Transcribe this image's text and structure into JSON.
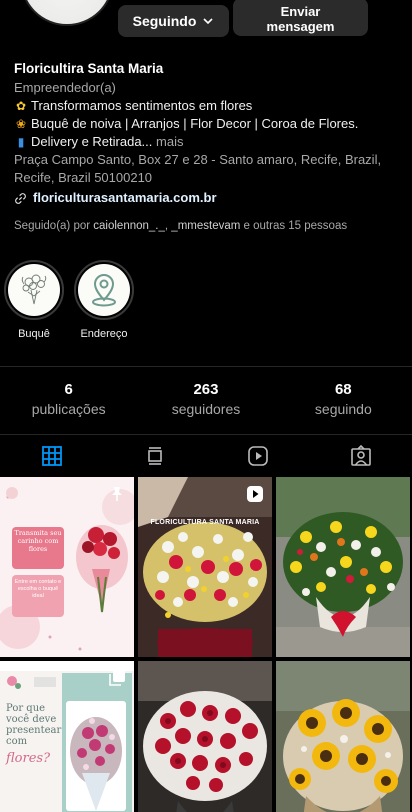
{
  "header": {
    "follow_button": "Seguindo",
    "message_button_line1": "Enviar",
    "message_button_line2": "mensagem"
  },
  "bio": {
    "name": "Floricultira Santa Maria",
    "category": "Empreendedor(a)",
    "lines": [
      "Transformamos sentimentos em flores",
      "Buquê de noiva | Arranjos | Flor Decor | Coroa de Flores.",
      "Delivery e Retirada..."
    ],
    "more": "mais",
    "address_line1": "Praça Campo Santo, Box 27 e 28 - Santo amaro, Recife, Brazil,",
    "address_line2": "Recife, Brazil 50100210",
    "link": "floriculturasantamaria.com.br"
  },
  "followed_by": {
    "prefix": "Seguido(a) por",
    "user1": "caiolennon_._",
    "user2": "_mmestevam",
    "suffix": "e outras 15 pessoas"
  },
  "highlights": [
    {
      "label": "Buquê",
      "icon": "bouquet-sketch-icon"
    },
    {
      "label": "Endereço",
      "icon": "map-pin-icon"
    }
  ],
  "stats": {
    "posts_count": "6",
    "posts_label": "publicações",
    "followers_count": "263",
    "followers_label": "seguidores",
    "following_count": "68",
    "following_label": "seguindo"
  },
  "tabs": [
    {
      "name": "grid",
      "icon": "grid-icon",
      "active": true
    },
    {
      "name": "feed",
      "icon": "feed-icon",
      "active": false
    },
    {
      "name": "reels",
      "icon": "reels-icon",
      "active": false
    },
    {
      "name": "tagged",
      "icon": "tagged-icon",
      "active": false
    }
  ],
  "posts": [
    {
      "id": "post-1",
      "kind": "pinned-graphic",
      "text1": "Transmita seu carinho com flores",
      "text2": "Entre em contato e escolha o buquê ideal"
    },
    {
      "id": "post-2",
      "kind": "reel",
      "caption": "FLORICULTURA SANTA MARIA"
    },
    {
      "id": "post-3",
      "kind": "photo"
    },
    {
      "id": "post-4",
      "kind": "carousel-graphic",
      "text1": "Por que você deve presentear com",
      "text2": "flores?"
    },
    {
      "id": "post-5",
      "kind": "photo"
    },
    {
      "id": "post-6",
      "kind": "photo"
    }
  ],
  "colors": {
    "background": "#000000",
    "button_bg": "#2b2b2b",
    "link": "#e0f1ff",
    "active_tab": "#0095f6",
    "muted_text": "#a8a8a8"
  }
}
